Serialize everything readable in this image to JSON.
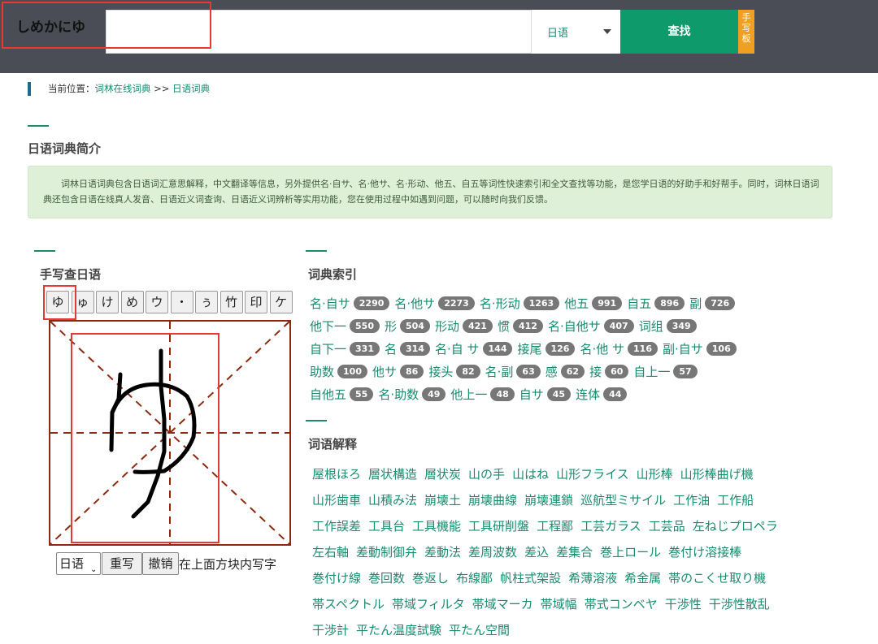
{
  "header": {
    "search_value": "しめかにゆ",
    "language": "日语",
    "search_label": "查找",
    "handwrite_label": "手写板"
  },
  "breadcrumb": {
    "prefix": "当前位置：",
    "home": "词林在线词典",
    "sep": ">>",
    "current": "日语词典"
  },
  "intro": {
    "title": "日语词典简介",
    "text": "词林日语词典包含日语词汇意思解释，中文翻译等信息，另外提供名·自サ、名·他サ、名·形动、他五、自五等词性快速索引和全文查找等功能，是您学日语的好助手和好帮手。同时，词林日语词典还包含日语在线真人发音、日语近义词查询、日语近义词辨析等实用功能，您在使用过程中如遇到问题，可以随时向我们反馈。"
  },
  "handwrite": {
    "title": "手写查日语",
    "candidates": [
      "ゆ",
      "ゅ",
      "け",
      "め",
      "ウ",
      "・",
      "ぅ",
      "竹",
      "印",
      "ケ"
    ],
    "language": "日语",
    "rewrite_label": "重写",
    "undo_label": "撤销",
    "hint": "在上面方块内写字"
  },
  "index": {
    "title": "词典索引",
    "rows": [
      [
        {
          "label": "名·自サ",
          "count": "2290"
        },
        {
          "label": "名·他サ",
          "count": "2273"
        },
        {
          "label": "名·形动",
          "count": "1263"
        },
        {
          "label": "他五",
          "count": "991"
        },
        {
          "label": "自五",
          "count": "896"
        },
        {
          "label": "副",
          "count": "726"
        }
      ],
      [
        {
          "label": "他下一",
          "count": "550"
        },
        {
          "label": "形",
          "count": "504"
        },
        {
          "label": "形动",
          "count": "421"
        },
        {
          "label": "惯",
          "count": "412"
        },
        {
          "label": "名·自他サ",
          "count": "407"
        },
        {
          "label": "词组",
          "count": "349"
        }
      ],
      [
        {
          "label": "自下一",
          "count": "331"
        },
        {
          "label": "名",
          "count": "314"
        },
        {
          "label": "名·自 サ",
          "count": "144"
        },
        {
          "label": "接尾",
          "count": "126"
        },
        {
          "label": "名·他 サ",
          "count": "116"
        },
        {
          "label": "副·自サ",
          "count": "106"
        }
      ],
      [
        {
          "label": "助数",
          "count": "100"
        },
        {
          "label": "他サ",
          "count": "86"
        },
        {
          "label": "接头",
          "count": "82"
        },
        {
          "label": "名·副",
          "count": "63"
        },
        {
          "label": "感",
          "count": "62"
        },
        {
          "label": "接",
          "count": "60"
        },
        {
          "label": "自上一",
          "count": "57"
        }
      ],
      [
        {
          "label": "自他五",
          "count": "55"
        },
        {
          "label": "名·助数",
          "count": "49"
        },
        {
          "label": "他上一",
          "count": "48"
        },
        {
          "label": "自サ",
          "count": "45"
        },
        {
          "label": "连体",
          "count": "44"
        }
      ]
    ]
  },
  "words": {
    "title": "词语解释",
    "rows": [
      [
        "屋根ほろ",
        "層状構造",
        "層状炭",
        "山の手",
        "山はね",
        "山形フライス",
        "山形棒",
        "山形棒曲げ機"
      ],
      [
        "山形歯車",
        "山積み法",
        "崩壊土",
        "崩壊曲線",
        "崩壊連鎖",
        "巡航型ミサイル",
        "工作油",
        "工作船"
      ],
      [
        "工作誤差",
        "工具台",
        "工具機能",
        "工具研削盤",
        "工程鄙",
        "工芸ガラス",
        "工芸品",
        "左ねじプロペラ"
      ],
      [
        "左右軸",
        "差動制御弁",
        "差動法",
        "差周波数",
        "差込",
        "差集合",
        "巻上ロール",
        "巻付け溶接棒"
      ],
      [
        "巻付け線",
        "巻回数",
        "巻返し",
        "布線鄙",
        "帆柱式架設",
        "希薄溶液",
        "希金属",
        "帯のこくせ取り機"
      ],
      [
        "帯スペクトル",
        "帯域フィルタ",
        "帯域マーカ",
        "帯域幅",
        "帯式コンベヤ",
        "干渉性",
        "干渉性散乱"
      ],
      [
        "干渉計",
        "平たん温度試験",
        "平たん空間"
      ]
    ]
  }
}
